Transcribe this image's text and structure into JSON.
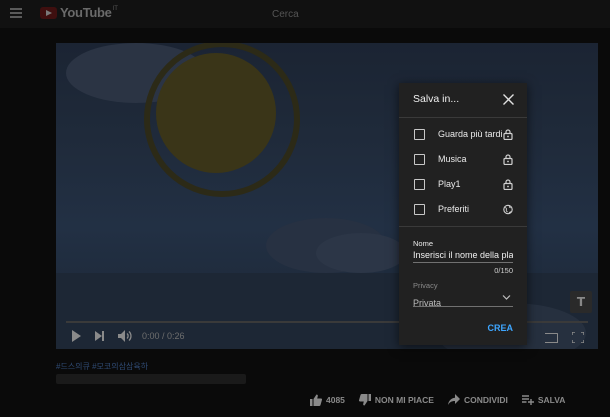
{
  "header": {
    "logo_text": "YouTube",
    "logo_region": "IT",
    "search_placeholder": "Cerca"
  },
  "player": {
    "time": "0:00 / 0:26",
    "watermark": "T"
  },
  "below_video": {
    "hashtags": "#드스의큐 #모코의삼삼육하",
    "actions": [
      {
        "label": "4085",
        "icon": "thumb-up-icon"
      },
      {
        "label": "NON MI PIACE",
        "icon": "thumb-down-icon"
      },
      {
        "label": "CONDIVIDI",
        "icon": "share-icon"
      },
      {
        "label": "SALVA",
        "icon": "playlist-add-icon"
      }
    ]
  },
  "save_dialog": {
    "title": "Salva in...",
    "playlists": [
      {
        "label": "Guarda più tardi",
        "checked": false,
        "privacy_icon": "lock-icon"
      },
      {
        "label": "Musica",
        "checked": false,
        "privacy_icon": "lock-icon"
      },
      {
        "label": "Play1",
        "checked": false,
        "privacy_icon": "lock-icon"
      },
      {
        "label": "Preferiti",
        "checked": false,
        "privacy_icon": "globe-icon"
      }
    ],
    "name_label": "Nome",
    "name_placeholder": "Inserisci il nome della pla",
    "name_counter": "0/150",
    "privacy_label": "Privacy",
    "privacy_value": "Privata",
    "create_button": "CREA"
  },
  "colors": {
    "accent": "#3ea6ff",
    "dialog_bg": "#212121",
    "page_bg": "#0a0a0a"
  }
}
